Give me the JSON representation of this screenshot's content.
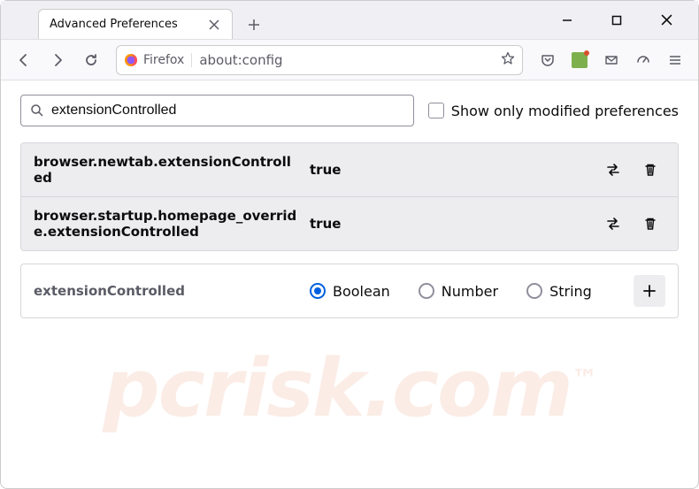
{
  "window": {
    "tab_title": "Advanced Preferences"
  },
  "urlbar": {
    "identity_label": "Firefox",
    "url": "about:config"
  },
  "search": {
    "value": "extensionControlled",
    "checkbox_label": "Show only modified preferences"
  },
  "prefs": [
    {
      "name": "browser.newtab.extensionControlled",
      "value": "true"
    },
    {
      "name": "browser.startup.homepage_override.extensionControlled",
      "value": "true"
    }
  ],
  "new_pref": {
    "name": "extensionControlled",
    "types": [
      "Boolean",
      "Number",
      "String"
    ],
    "selected": 0
  },
  "watermark": "pcrisk.com"
}
